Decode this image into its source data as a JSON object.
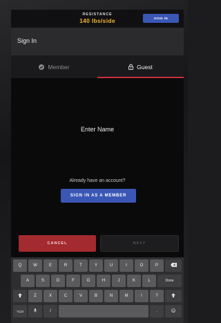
{
  "topbar": {
    "resistance_label": "RESISTANCE",
    "resistance_value": "140 lbs/side",
    "sign_in_label": "SIGN IN"
  },
  "header": {
    "title": "Sign In"
  },
  "tabs": [
    {
      "label": "Member",
      "icon": "check-circle-icon",
      "active": false
    },
    {
      "label": "Guest",
      "icon": "lock-icon",
      "active": true
    }
  ],
  "main": {
    "prompt": "Enter Name",
    "have_account": "Already have an account?",
    "member_button": "SIGN IN AS A MEMBER"
  },
  "actions": {
    "cancel": "CANCEL",
    "next": "NEXT"
  },
  "keyboard": {
    "row1": [
      "Q",
      "W",
      "E",
      "R",
      "T",
      "Y",
      "U",
      "I",
      "O",
      "P"
    ],
    "row2": [
      "A",
      "S",
      "D",
      "F",
      "G",
      "H",
      "J",
      "K",
      "L"
    ],
    "row3": [
      "Z",
      "X",
      "C",
      "V",
      "B",
      "N",
      "M",
      "!",
      "?"
    ],
    "done": "Done",
    "symbols": "?123",
    "comma": ",",
    "slash": "/",
    "period": ".",
    "backspace_icon": "backspace-icon",
    "shift_icon": "shift-icon",
    "mic_icon": "mic-icon",
    "emoji_icon": "emoji-icon"
  },
  "colors": {
    "accent_blue": "#3b57b5",
    "accent_red": "#c8313a",
    "cancel_red": "#a32a2e",
    "resistance_yellow": "#f2b632"
  }
}
